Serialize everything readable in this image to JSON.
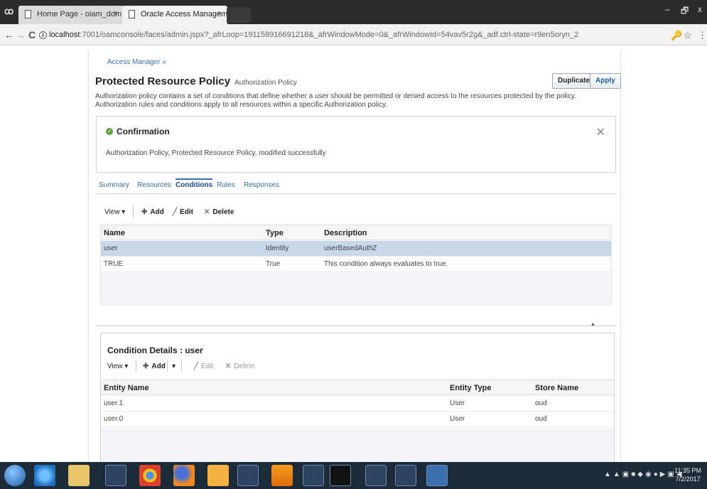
{
  "browser": {
    "tabs": [
      {
        "title": "Home Page - oiam_dom",
        "close": "×"
      },
      {
        "title": "Oracle Access Managem",
        "close": "×"
      }
    ],
    "url_host": "localhost",
    "url_rest": ":7001/oamconsole/faces/admin.jspx?_afrLoop=191158916691218&_afrWindowMode=0&_afrWindowId=54vav5r2g&_adf.ctrl-state=r9en5oryn_2",
    "info_glyph": "i",
    "nav": {
      "back": "←",
      "forward": "→",
      "reload": "C"
    },
    "right_icons": {
      "extension": "🔑",
      "star": "☆",
      "menu": "⋮"
    },
    "window_controls": {
      "minimize": "–",
      "maximize": "🗗",
      "close": "x"
    }
  },
  "page": {
    "breadcrumb": "Access Manager »",
    "title": "Protected Resource Policy",
    "subtitle": "Authorization Policy",
    "duplicate_label": "Duplicate",
    "apply_label": "Apply",
    "description": "Authorization policy contains a set of conditions that define whether a user should be permitted or denied access to the resources protected by the policy. Authorization rules and conditions apply to all resources within a specific Authorization policy."
  },
  "confirmation": {
    "title": "Confirmation",
    "message": "Authorization Policy, Protected Resource Policy, modified successfully",
    "close_glyph": "✕"
  },
  "subtabs": [
    {
      "label": "Summary"
    },
    {
      "label": "Resources"
    },
    {
      "label": "Conditions"
    },
    {
      "label": "Rules"
    },
    {
      "label": "Responses"
    }
  ],
  "active_subtab": "Conditions",
  "conditions_toolbar": {
    "view": "View ▾",
    "add": "Add",
    "edit": "Edit",
    "delete": "Delete"
  },
  "conditions_table": {
    "headers": [
      "Name",
      "Type",
      "Description"
    ],
    "rows": [
      {
        "name": "user",
        "type": "Identity",
        "description": "userBasedAuthZ",
        "selected": true
      },
      {
        "name": "TRUE",
        "type": "True",
        "description": "This condition always evaluates to true.",
        "selected": false
      }
    ]
  },
  "details": {
    "title": "Condition Details : user",
    "toolbar": {
      "view": "View ▾",
      "add": "Add",
      "add_menu": "▾",
      "edit": "Edit",
      "delete": "Delete"
    },
    "headers": [
      "Entity Name",
      "Entity Type",
      "Store Name"
    ],
    "rows": [
      {
        "entity_name": "user.1",
        "entity_type": "User",
        "store_name": "oud"
      },
      {
        "entity_name": "user.0",
        "entity_type": "User",
        "store_name": "oud"
      }
    ]
  },
  "taskbar": {
    "clock_time": "11:35 PM",
    "clock_date": "7/2/2017",
    "apps": [
      "ie-icon",
      "file-explorer-icon",
      "users-icon",
      "chrome-icon",
      "firefox-icon",
      "folder-icon",
      "notepad-icon",
      "vlc-icon",
      "document-icon",
      "terminal-icon",
      "snipping-tool-icon",
      "network-icon",
      "app-icon"
    ]
  },
  "colors": {
    "link": "#3a6ea5",
    "selected_row": "#c6d8ea",
    "success": "#5aa33a",
    "taskbar": "#1c2a3a"
  }
}
